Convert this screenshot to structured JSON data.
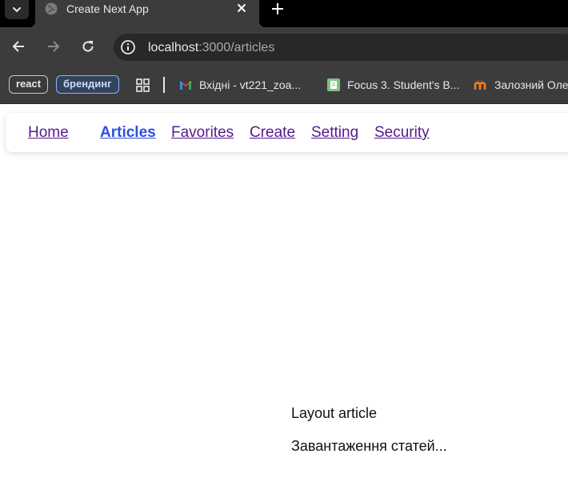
{
  "browser": {
    "tab": {
      "title": "Create Next App"
    },
    "address": {
      "host": "localhost",
      "path": ":3000/articles"
    },
    "bookmarks": {
      "react": "react",
      "branding": "брендинг",
      "gmail": "Вхідні - vt221_zoa...",
      "focus": "Focus 3. Student's B...",
      "zaloznyi": "Залозний Оле"
    },
    "icons": [
      "tab-search-icon",
      "globe-icon",
      "close-icon",
      "plus-icon",
      "back-arrow-icon",
      "forward-arrow-icon",
      "reload-icon",
      "info-icon",
      "apps-grid-icon",
      "gmail-icon",
      "book-icon",
      "moodle-icon"
    ]
  },
  "nav": {
    "home": "Home",
    "articles": "Articles",
    "favorites": "Favorites",
    "create": "Create",
    "setting": "Setting",
    "security": "Security"
  },
  "main": {
    "layout_title": "Layout article",
    "loading_text": "Завантаження статей..."
  },
  "colors": {
    "link_visited": "#551a8b",
    "link_active": "#2c4fe0",
    "chrome_dark": "#3c3c3c"
  }
}
